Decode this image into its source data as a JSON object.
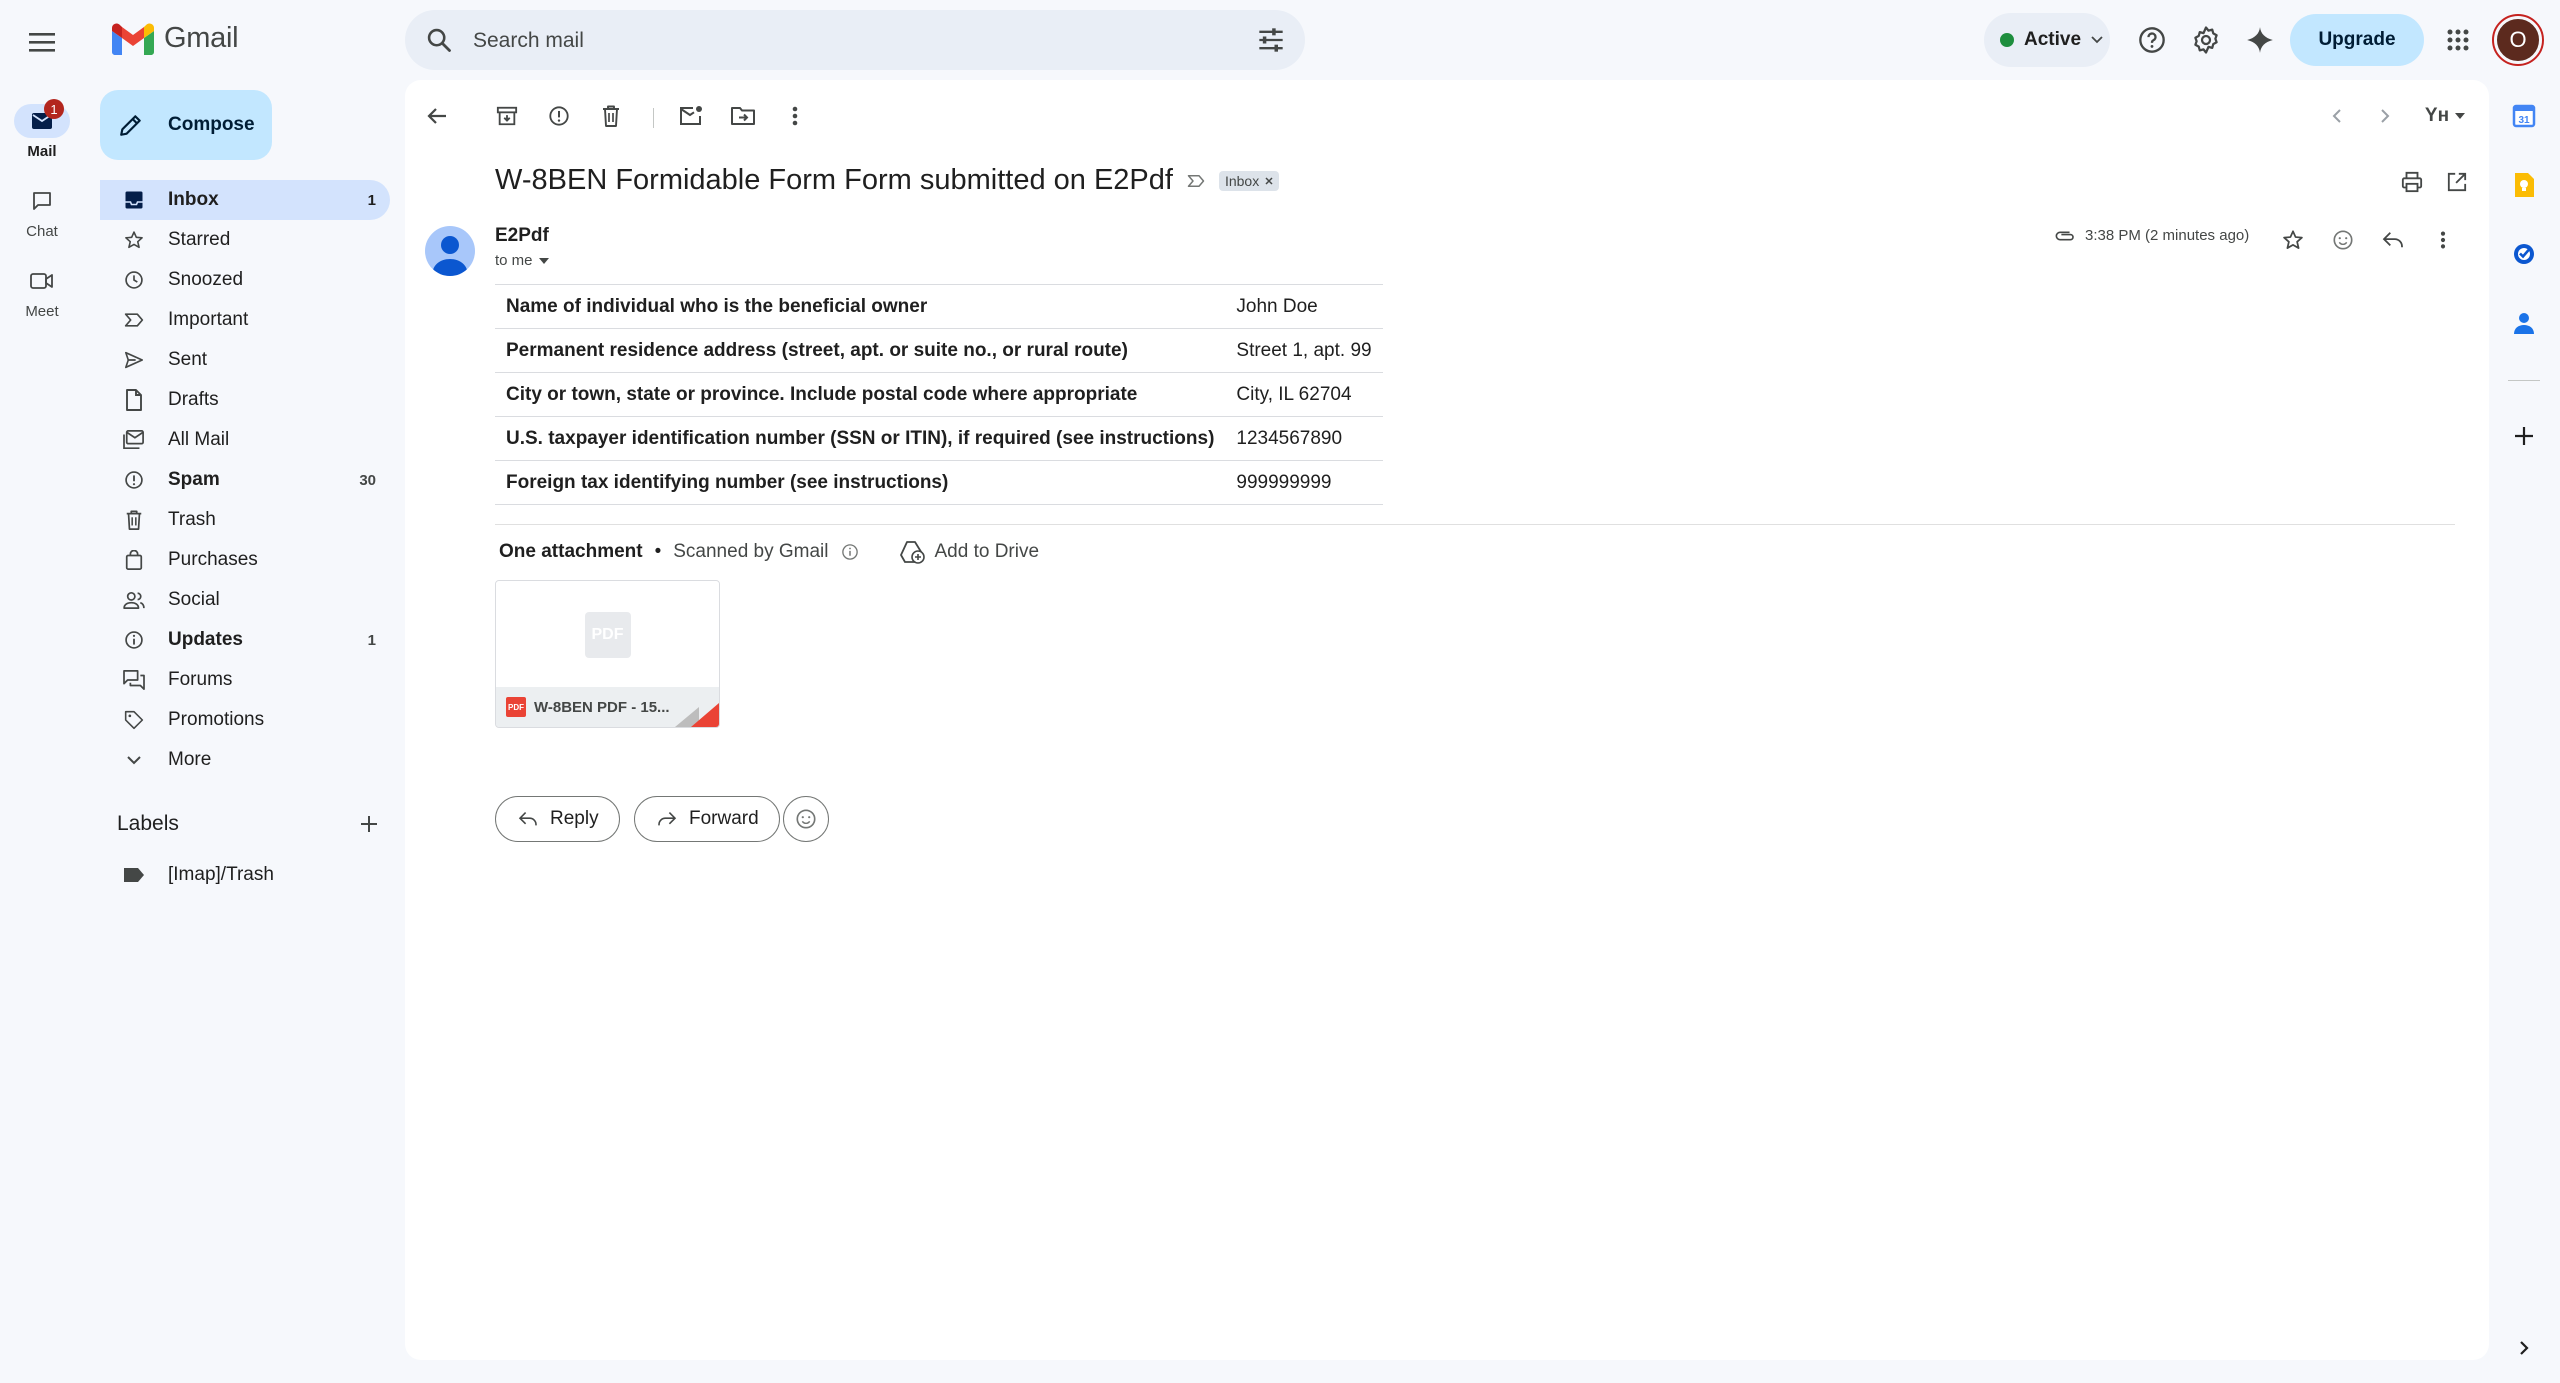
{
  "header": {
    "brand": "Gmail",
    "search_placeholder": "Search mail",
    "status": "Active",
    "upgrade_label": "Upgrade",
    "avatar_letter": "O"
  },
  "rail": {
    "mail": {
      "label": "Mail",
      "badge": "1"
    },
    "chat": {
      "label": "Chat"
    },
    "meet": {
      "label": "Meet"
    }
  },
  "sidebar": {
    "compose_label": "Compose",
    "items": [
      {
        "label": "Inbox",
        "count": "1",
        "icon": "inbox-icon"
      },
      {
        "label": "Starred",
        "count": "",
        "icon": "star-icon"
      },
      {
        "label": "Snoozed",
        "count": "",
        "icon": "clock-icon"
      },
      {
        "label": "Important",
        "count": "",
        "icon": "important-icon"
      },
      {
        "label": "Sent",
        "count": "",
        "icon": "send-icon"
      },
      {
        "label": "Drafts",
        "count": "",
        "icon": "draft-icon"
      },
      {
        "label": "All Mail",
        "count": "",
        "icon": "all-mail-icon"
      },
      {
        "label": "Spam",
        "count": "30",
        "icon": "spam-icon"
      },
      {
        "label": "Trash",
        "count": "",
        "icon": "trash-icon"
      },
      {
        "label": "Purchases",
        "count": "",
        "icon": "purchases-icon"
      },
      {
        "label": "Social",
        "count": "",
        "icon": "social-icon"
      },
      {
        "label": "Updates",
        "count": "1",
        "icon": "updates-icon"
      },
      {
        "label": "Forums",
        "count": "",
        "icon": "forums-icon"
      },
      {
        "label": "Promotions",
        "count": "",
        "icon": "tag-icon"
      },
      {
        "label": "More",
        "count": "",
        "icon": "chevron-down-icon"
      }
    ],
    "labels_title": "Labels",
    "labels": [
      {
        "label": "[Imap]/Trash"
      }
    ]
  },
  "toolbar": {
    "lang": "Yн"
  },
  "message": {
    "subject": "W-8BEN Formidable Form Form submitted on E2Pdf",
    "chip": "Inbox",
    "sender": "E2Pdf",
    "to": "to me",
    "time": "3:38 PM (2 minutes ago)",
    "fields": [
      {
        "key": "Name of individual who is the beneficial owner",
        "value": "John Doe"
      },
      {
        "key": "Permanent residence address (street, apt. or suite no., or rural route)",
        "value": "Street 1, apt. 99"
      },
      {
        "key": "City or town, state or province. Include postal code where appropriate",
        "value": "City, IL 62704"
      },
      {
        "key": "U.S. taxpayer identification number (SSN or ITIN), if required (see instructions)",
        "value": "1234567890"
      },
      {
        "key": "Foreign tax identifying number (see instructions)",
        "value": "999999999"
      }
    ]
  },
  "attachments": {
    "title": "One attachment",
    "bullet": "•",
    "scanned": "Scanned by Gmail",
    "add_to_drive": "Add to Drive",
    "file_name": "W-8BEN PDF - 15...",
    "thumb_label": "PDF",
    "type_label": "PDF"
  },
  "actions": {
    "reply": "Reply",
    "forward": "Forward"
  },
  "colors": {
    "accent": "#0b57d0",
    "selected": "#d3e3fd",
    "compose": "#c2e7ff",
    "badge": "#b3261e"
  }
}
